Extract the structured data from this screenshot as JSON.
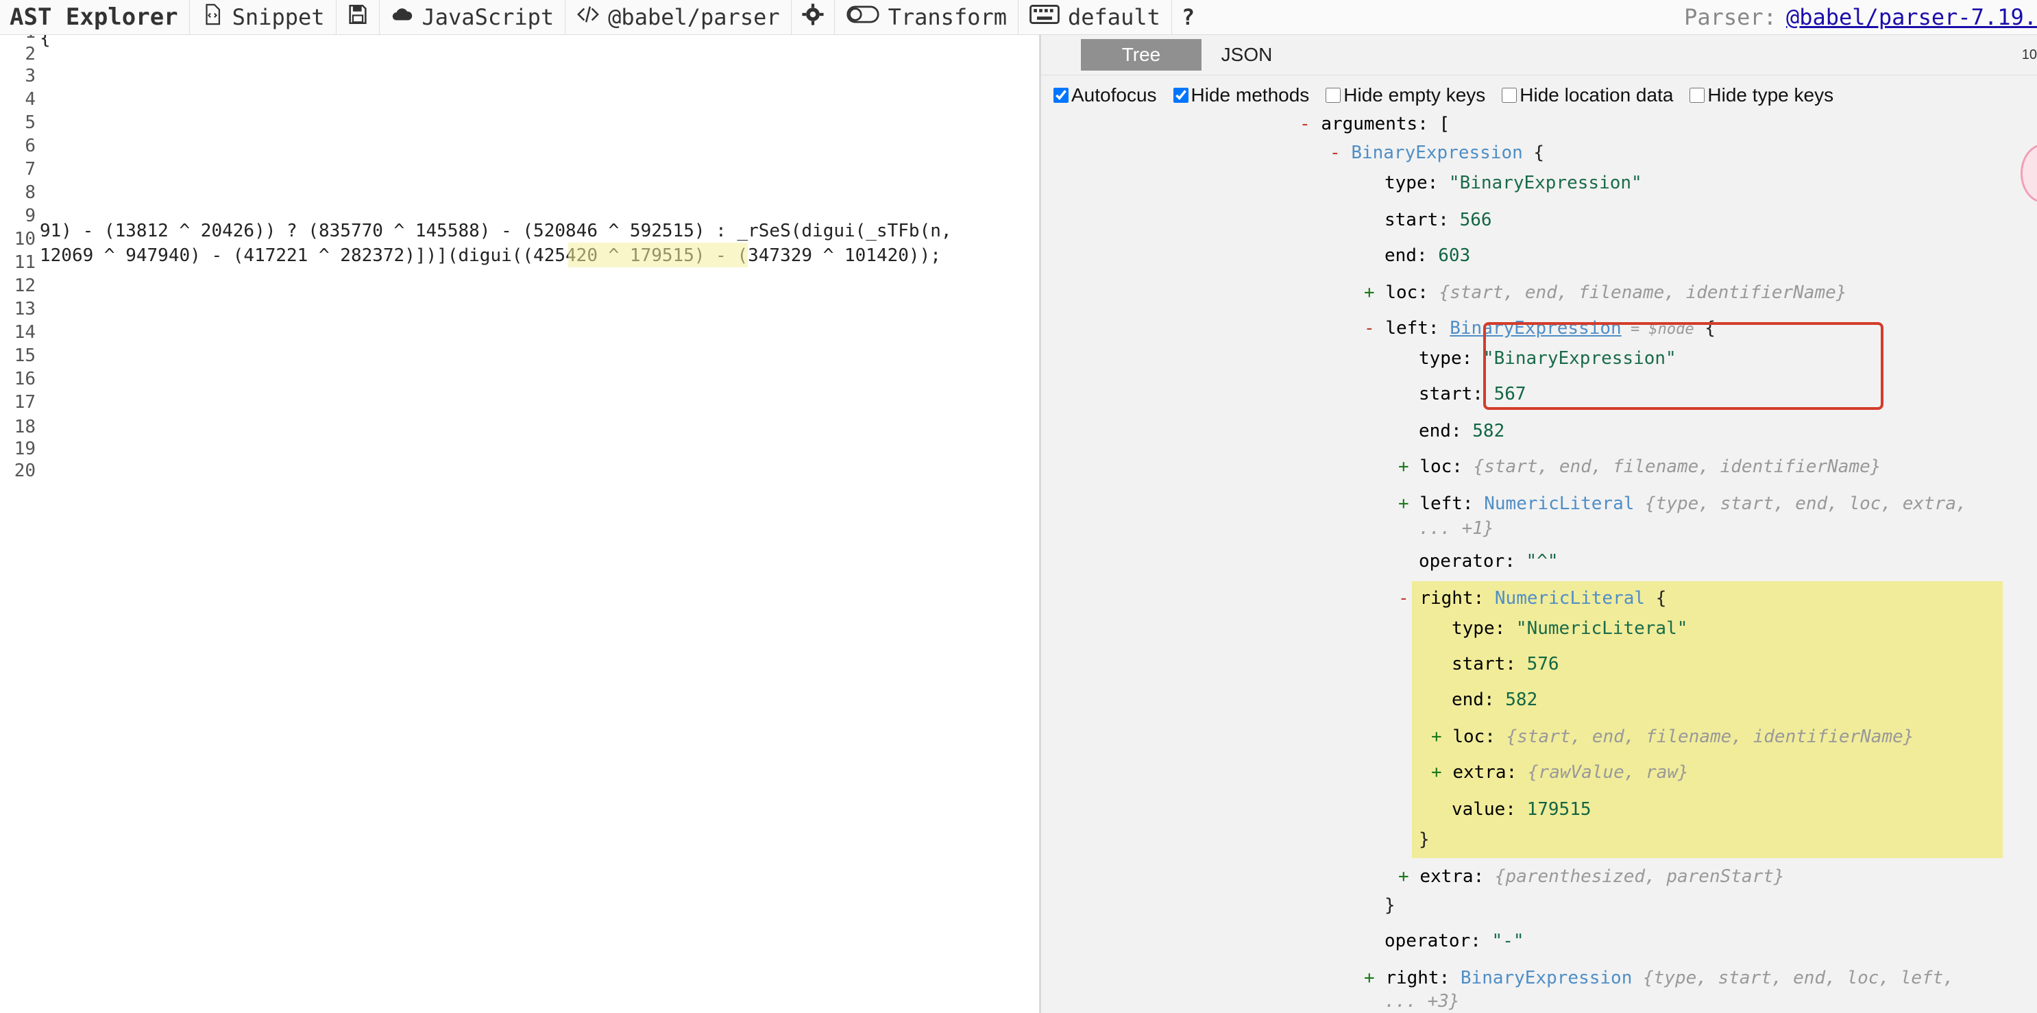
{
  "toolbar": {
    "title": "AST Explorer",
    "snippet": "Snippet",
    "language": "JavaScript",
    "parser": "@babel/parser",
    "transform": "Transform",
    "keymap": "default",
    "help": "?",
    "parser_label": "Parser:",
    "parser_version": "@babel/parser-7.19."
  },
  "editor": {
    "line_numbers": [
      "1",
      "2",
      "3",
      "4",
      "5",
      "6",
      "7",
      "8",
      "9",
      "10",
      "11",
      "12",
      "13",
      "14",
      "15",
      "16",
      "17",
      "18",
      "19",
      "20"
    ],
    "line1": "{",
    "line18": "91) - (13812 ^ 20426)) ? (835770 ^ 145588) - (520846 ^ 592515) : _rSeS(digui(_sTFb(n,",
    "line20": "12069 ^ 947940) - (417221 ^ 282372)])](digui((425420 ^ 179515) - (347329 ^ 101420));"
  },
  "ast_panel": {
    "tabs": [
      "Tree",
      "JSON"
    ],
    "size_note": "10",
    "options": [
      "Autofocus",
      "Hide methods",
      "Hide empty keys",
      "Hide location data",
      "Hide type keys"
    ],
    "options_checked": [
      true,
      true,
      false,
      false,
      false
    ],
    "lines": {
      "arguments": "arguments: [",
      "binexp1": "BinaryExpression",
      "type1": "\"BinaryExpression\"",
      "start1": "566",
      "end1": "603",
      "loc1": "{start, end, filename, identifierName}",
      "left_type": "BinaryExpression",
      "node_ref": "= $node",
      "type2": "\"BinaryExpression\"",
      "start2": "567",
      "end2": "582",
      "loc2": "{start, end, filename, identifierName}",
      "left2": "NumericLiteral",
      "left2_summary": "{type, start, end, loc, extra,",
      "left2_more": "... +1}",
      "operator1": "\"^\"",
      "right1": "NumericLiteral",
      "type3": "\"NumericLiteral\"",
      "start3": "576",
      "end3": "582",
      "loc3": "{start, end, filename, identifierName}",
      "extra3": "{rawValue, raw}",
      "value3": "179515",
      "extra2": "{parenthesized, parenStart}",
      "operator2": "\"-\"",
      "right2": "BinaryExpression",
      "right2_summary": "{type, start, end, loc, left,",
      "right2_more": "... +3}"
    }
  }
}
